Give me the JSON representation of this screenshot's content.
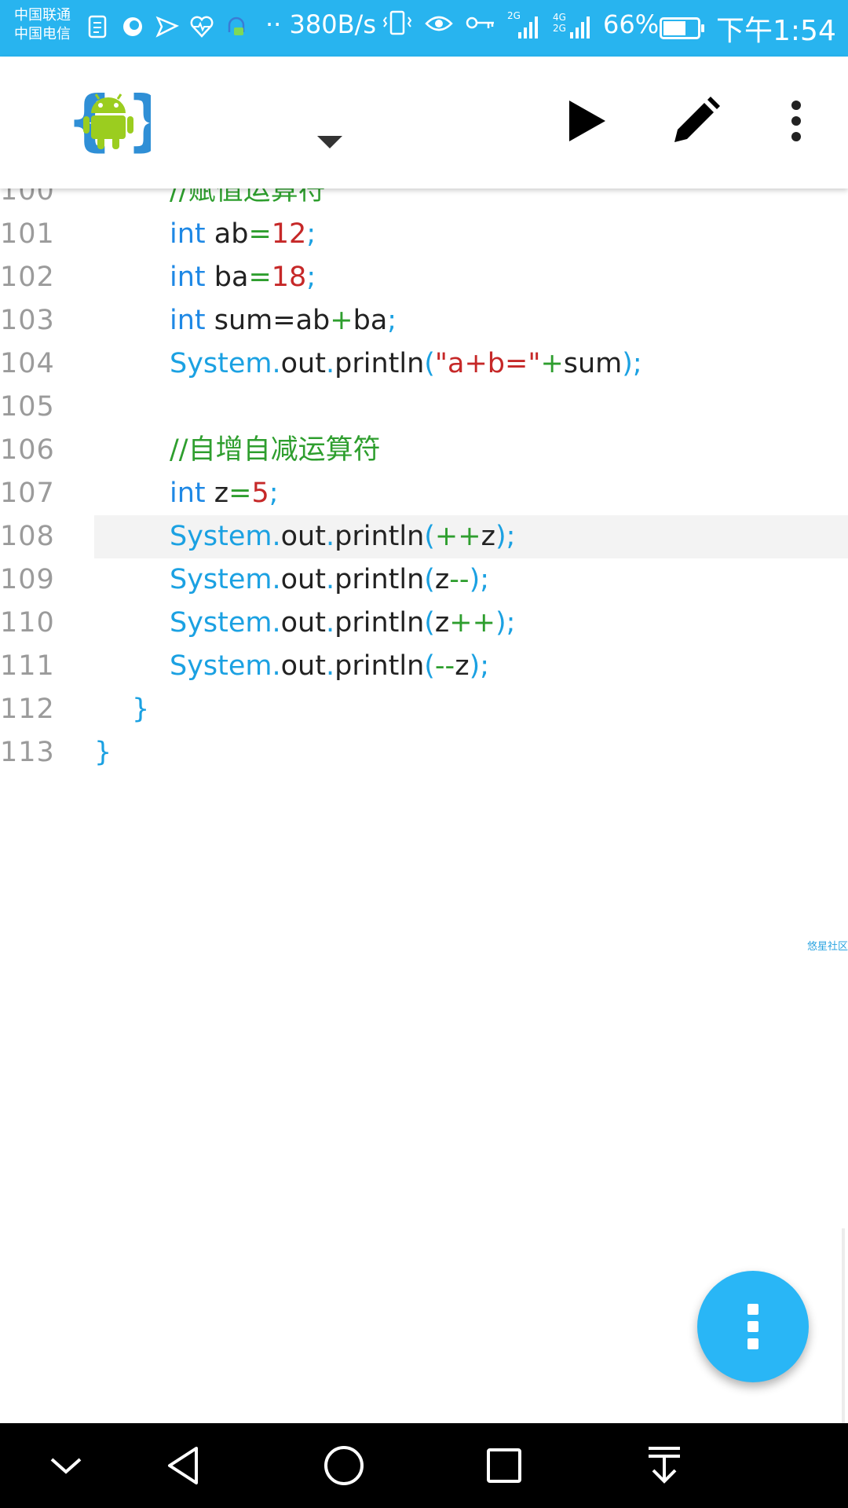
{
  "status_bar": {
    "carrier_1": "中国联通",
    "carrier_2": "中国电信",
    "net_speed": "380B/s",
    "signal_1": "2G",
    "signal_2": "4G 2G",
    "battery_percent": "66%",
    "battery_level": 0.66,
    "time": "下午1:54",
    "icons": [
      "document-icon",
      "browser-icon",
      "send-icon",
      "heart-icon",
      "assistant-icon",
      "vibrate-icon",
      "eye-icon",
      "key-icon",
      "signal-icon",
      "signal-icon",
      "battery-icon"
    ]
  },
  "app_bar": {
    "logo": "android-logo-icon",
    "actions": [
      "run-icon",
      "edit-icon",
      "more-vert-icon"
    ]
  },
  "editor": {
    "partial_top_line": "//赋值运算符",
    "lines": [
      {
        "num": "101",
        "indent": 2,
        "tokens": [
          [
            "kw",
            "int"
          ],
          [
            "t",
            " ab"
          ],
          [
            "op",
            "="
          ],
          [
            "num",
            "12"
          ],
          [
            "pun",
            ";"
          ]
        ]
      },
      {
        "num": "102",
        "indent": 2,
        "tokens": [
          [
            "kw",
            "int"
          ],
          [
            "t",
            " ba"
          ],
          [
            "op",
            "="
          ],
          [
            "num",
            "18"
          ],
          [
            "pun",
            ";"
          ]
        ]
      },
      {
        "num": "103",
        "indent": 2,
        "tokens": [
          [
            "kw",
            "int"
          ],
          [
            "t",
            " sum=ab"
          ],
          [
            "op",
            "+"
          ],
          [
            "t",
            "ba"
          ],
          [
            "pun",
            ";"
          ]
        ]
      },
      {
        "num": "104",
        "indent": 2,
        "tokens": [
          [
            "sys",
            "System."
          ],
          [
            "t",
            "out"
          ],
          [
            "pun",
            "."
          ],
          [
            "t",
            "println"
          ],
          [
            "pun",
            "("
          ],
          [
            "str",
            "\"a+b=\""
          ],
          [
            "op",
            "+"
          ],
          [
            "t",
            "sum"
          ],
          [
            "pun",
            ");"
          ]
        ]
      },
      {
        "num": "105",
        "indent": 0,
        "tokens": []
      },
      {
        "num": "106",
        "indent": 2,
        "tokens": [
          [
            "com",
            "//自增自减运算符"
          ]
        ]
      },
      {
        "num": "107",
        "indent": 2,
        "tokens": [
          [
            "kw",
            "int"
          ],
          [
            "t",
            " z"
          ],
          [
            "op",
            "="
          ],
          [
            "num",
            "5"
          ],
          [
            "pun",
            ";"
          ]
        ]
      },
      {
        "num": "108",
        "indent": 2,
        "current": true,
        "tokens": [
          [
            "sys",
            "System."
          ],
          [
            "t",
            "out"
          ],
          [
            "pun",
            "."
          ],
          [
            "t",
            "println"
          ],
          [
            "pun",
            "("
          ],
          [
            "op",
            "++"
          ],
          [
            "t",
            "z"
          ],
          [
            "pun",
            ");"
          ]
        ]
      },
      {
        "num": "109",
        "indent": 2,
        "tokens": [
          [
            "sys",
            "System."
          ],
          [
            "t",
            "out"
          ],
          [
            "pun",
            "."
          ],
          [
            "t",
            "println"
          ],
          [
            "pun",
            "("
          ],
          [
            "t",
            "z"
          ],
          [
            "op",
            "--"
          ],
          [
            "pun",
            ");"
          ]
        ]
      },
      {
        "num": "110",
        "indent": 2,
        "tokens": [
          [
            "sys",
            "System."
          ],
          [
            "t",
            "out"
          ],
          [
            "pun",
            "."
          ],
          [
            "t",
            "println"
          ],
          [
            "pun",
            "("
          ],
          [
            "t",
            "z"
          ],
          [
            "op",
            "++"
          ],
          [
            "pun",
            ");"
          ]
        ]
      },
      {
        "num": "111",
        "indent": 2,
        "tokens": [
          [
            "sys",
            "System."
          ],
          [
            "t",
            "out"
          ],
          [
            "pun",
            "."
          ],
          [
            "t",
            "println"
          ],
          [
            "pun",
            "("
          ],
          [
            "op",
            "--"
          ],
          [
            "t",
            "z"
          ],
          [
            "pun",
            ");"
          ]
        ]
      },
      {
        "num": "112",
        "indent": 1,
        "tokens": [
          [
            "pun",
            "}"
          ]
        ]
      },
      {
        "num": "113",
        "indent": 0,
        "tokens": [
          [
            "pun",
            "}"
          ]
        ]
      }
    ],
    "watermark": "悠星社区"
  },
  "fab": {
    "icon": "more-vert-icon"
  },
  "nav_bar": {
    "buttons": [
      "collapse-icon",
      "back-icon",
      "home-icon",
      "recents-icon",
      "notification-pull-icon"
    ]
  }
}
